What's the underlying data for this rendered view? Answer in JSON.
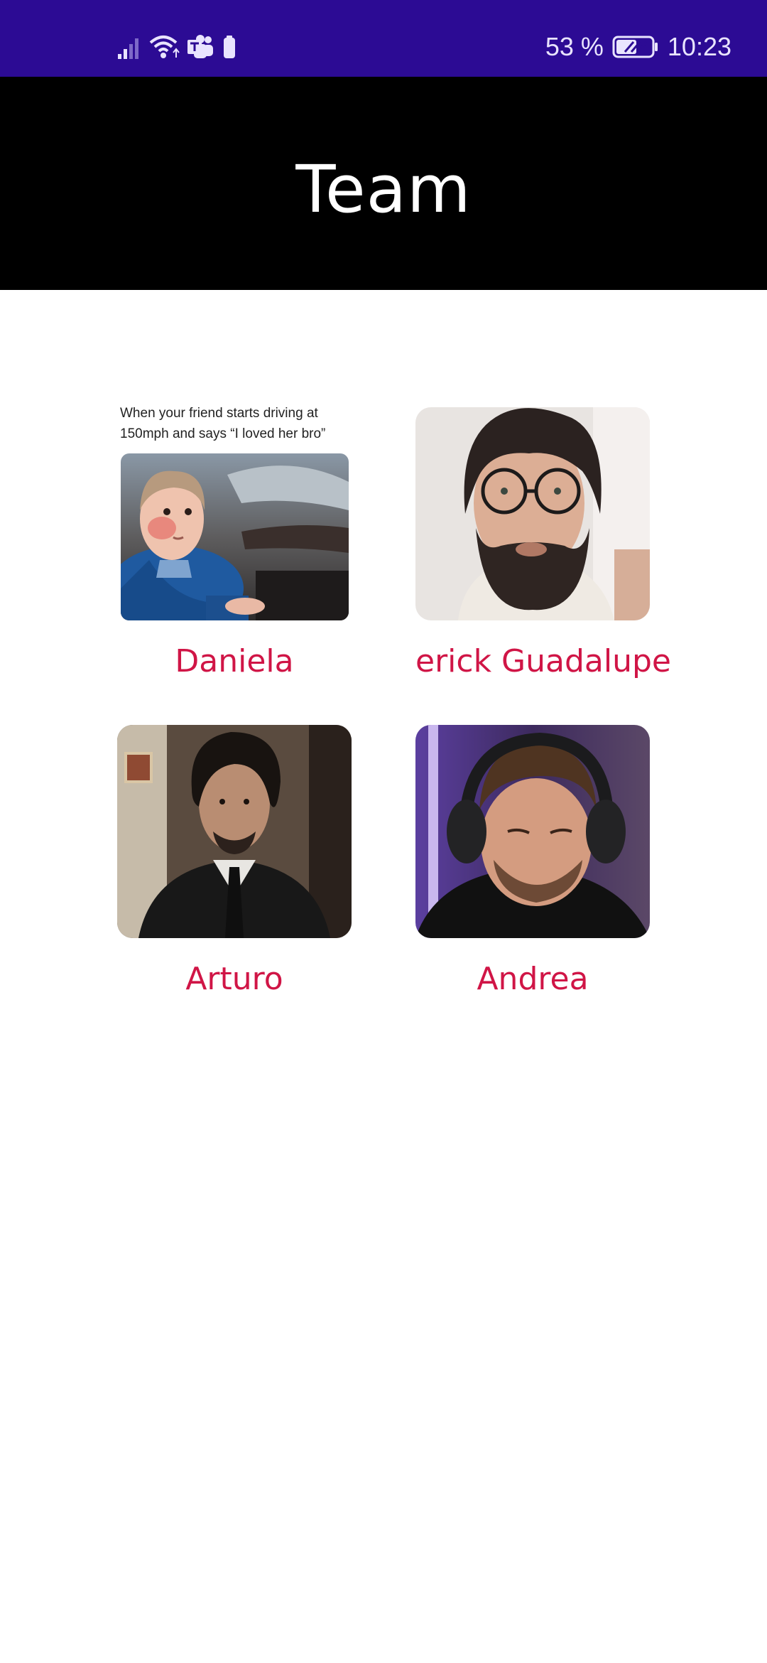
{
  "status_bar": {
    "battery_percent": "53 %",
    "time": "10:23",
    "icons": [
      "signal-icon",
      "wifi-icon",
      "teams-icon",
      "battery-saver-icon",
      "battery-icon"
    ],
    "color": "#2c0b94"
  },
  "header": {
    "title": "Team",
    "background": "#000000"
  },
  "team": {
    "accent_color": "#d01546",
    "members": [
      {
        "name": "Daniela",
        "meme_caption": "When your friend starts driving at 150mph and says “I loved her bro”"
      },
      {
        "name": "erick Guadalupe"
      },
      {
        "name": "Arturo"
      },
      {
        "name": "Andrea"
      }
    ]
  }
}
